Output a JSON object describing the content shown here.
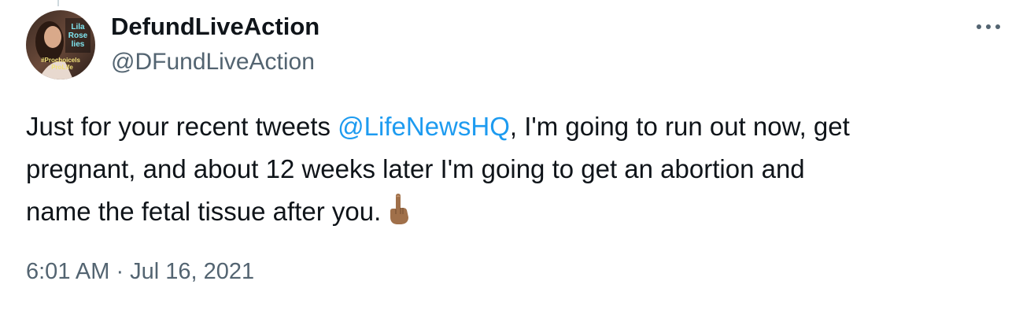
{
  "author": {
    "display_name": "DefundLiveAction",
    "handle": "@DFundLiveAction",
    "avatar_text": [
      "Lila",
      "Rose",
      "lies",
      "#Prochoicels",
      "ProLife"
    ]
  },
  "tweet": {
    "text_line1_before": "Just for your recent tweets ",
    "mention": "@LifeNewsHQ",
    "text_line1_after": ", I'm going to run out now, get",
    "text_line2": "pregnant, and about 12 weeks later I'm going to get an abortion and",
    "text_line3": "name the fetal tissue after you.",
    "emoji": "middle-finger-medium-dark-skin-tone"
  },
  "meta": {
    "timestamp": "6:01 AM · Jul 16, 2021"
  },
  "icons": {
    "more": "more-horizontal-icon"
  },
  "colors": {
    "text_primary": "#0f1419",
    "text_secondary": "#536471",
    "link": "#1d9bf0",
    "emoji_skin": "#a0704a"
  }
}
